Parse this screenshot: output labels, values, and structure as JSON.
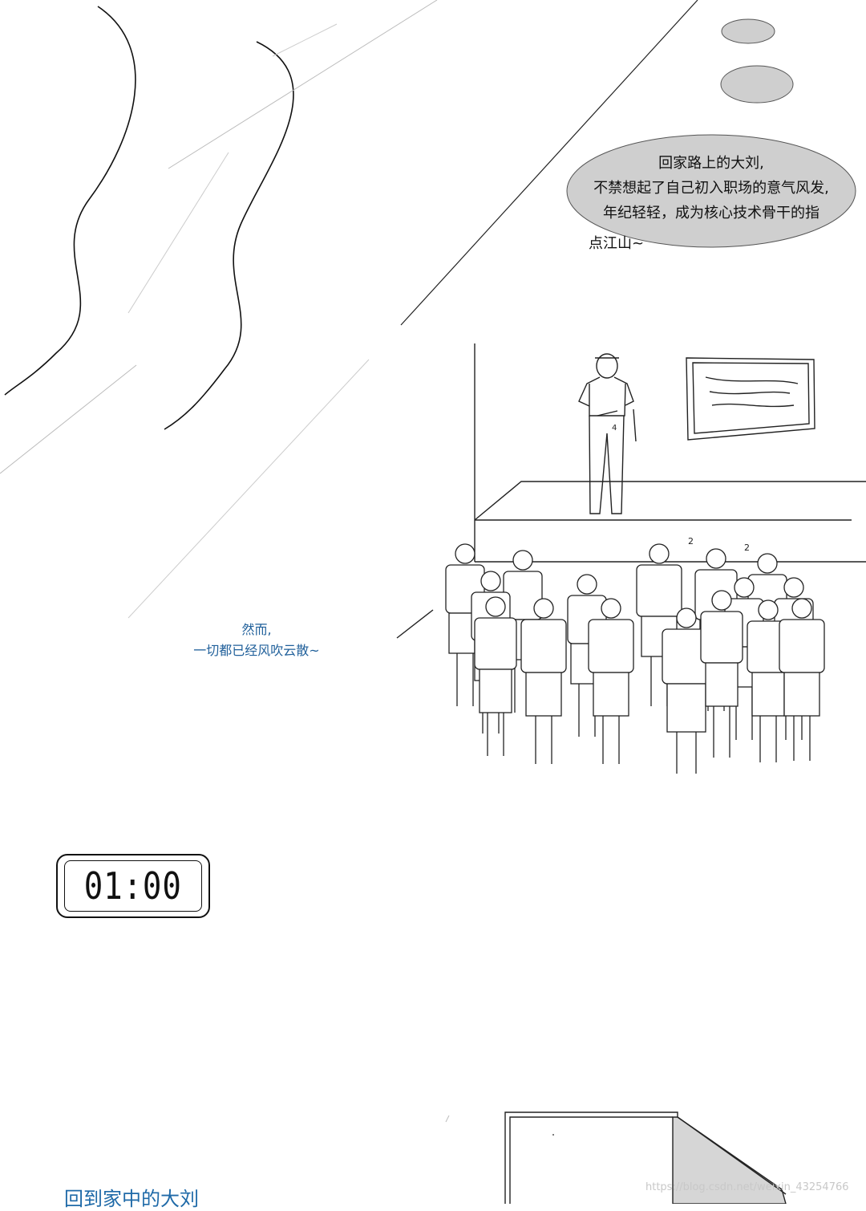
{
  "speech_bubble": {
    "lines": [
      "回家路上的大刘,",
      "不禁想起了自己初入职场的意气风发,",
      "年纪轻轻，成为核心技术骨干的指"
    ],
    "overflow_line": "点江山~"
  },
  "narration": {
    "lines": [
      "然而,",
      "一切都已经风吹云散~"
    ]
  },
  "clock": {
    "time": "01:00"
  },
  "caption_bottom": "回到家中的大刘",
  "watermark": "https://blog.csdn.net/weixin_43254766",
  "stage_labels": {
    "speaker_tag": "4",
    "listener_tag_1": "2",
    "listener_tag_2": "2"
  },
  "colors": {
    "narration": "#1f5f9a",
    "caption": "#1f6aa8",
    "bubble_fill": "#cfcfcf"
  }
}
